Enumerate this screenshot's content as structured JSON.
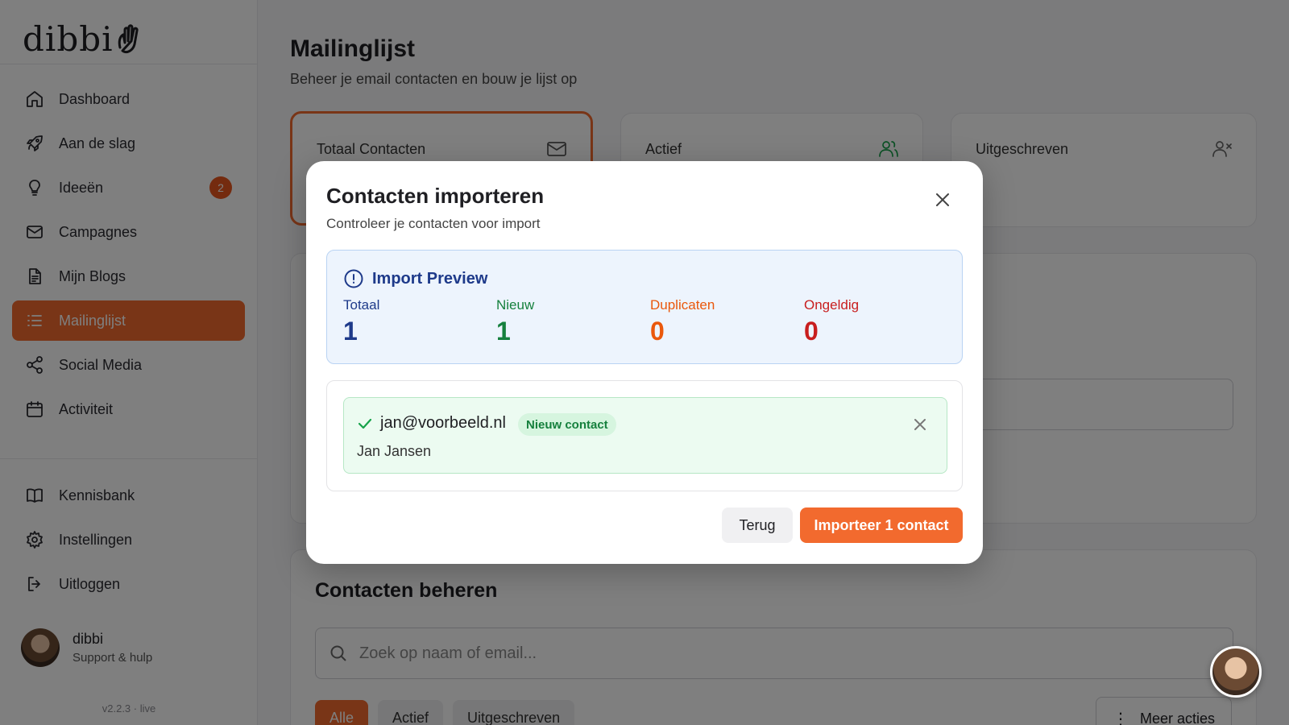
{
  "brand": {
    "logo_text": "dibbi",
    "accent": "#f26a2e"
  },
  "sidebar": {
    "items": [
      {
        "label": "Dashboard",
        "icon": "home-icon"
      },
      {
        "label": "Aan de slag",
        "icon": "rocket-icon"
      },
      {
        "label": "Ideeën",
        "icon": "lightbulb-icon",
        "badge": "2"
      },
      {
        "label": "Campagnes",
        "icon": "mail-icon"
      },
      {
        "label": "Mijn Blogs",
        "icon": "document-icon"
      },
      {
        "label": "Mailinglijst",
        "icon": "list-icon",
        "active": true
      },
      {
        "label": "Social Media",
        "icon": "share-icon"
      },
      {
        "label": "Activiteit",
        "icon": "calendar-icon"
      }
    ],
    "bottom_items": [
      {
        "label": "Kennisbank",
        "icon": "book-icon"
      },
      {
        "label": "Instellingen",
        "icon": "gear-icon"
      },
      {
        "label": "Uitloggen",
        "icon": "logout-icon"
      }
    ],
    "user": {
      "name": "dibbi",
      "subtitle": "Support & hulp"
    },
    "version": "v2.2.3 · live"
  },
  "page": {
    "title": "Mailinglijst",
    "subtitle": "Beheer je email contacten en bouw je lijst op",
    "stats": [
      {
        "label": "Totaal Contacten",
        "icon": "mail-icon"
      },
      {
        "label": "Actief",
        "icon": "users-icon"
      },
      {
        "label": "Uitgeschreven",
        "icon": "user-x-icon"
      }
    ],
    "manage": {
      "title": "Contacten beheren",
      "search_placeholder": "Zoek op naam of email...",
      "filters": [
        "Alle",
        "Actief",
        "Uitgeschreven"
      ],
      "more_label": "Meer acties"
    }
  },
  "modal": {
    "title": "Contacten importeren",
    "subtitle": "Controleer je contacten voor import",
    "preview": {
      "heading": "Import Preview",
      "stats": [
        {
          "label": "Totaal",
          "value": "1",
          "color": "#1e3a8a"
        },
        {
          "label": "Nieuw",
          "value": "1",
          "color": "#15803d"
        },
        {
          "label": "Duplicaten",
          "value": "0",
          "color": "#ea580c"
        },
        {
          "label": "Ongeldig",
          "value": "0",
          "color": "#c81e1e"
        }
      ]
    },
    "contacts": [
      {
        "email": "jan@voorbeeld.nl",
        "tag": "Nieuw contact",
        "name": "Jan Jansen"
      }
    ],
    "back_label": "Terug",
    "import_label": "Importeer 1 contact"
  }
}
